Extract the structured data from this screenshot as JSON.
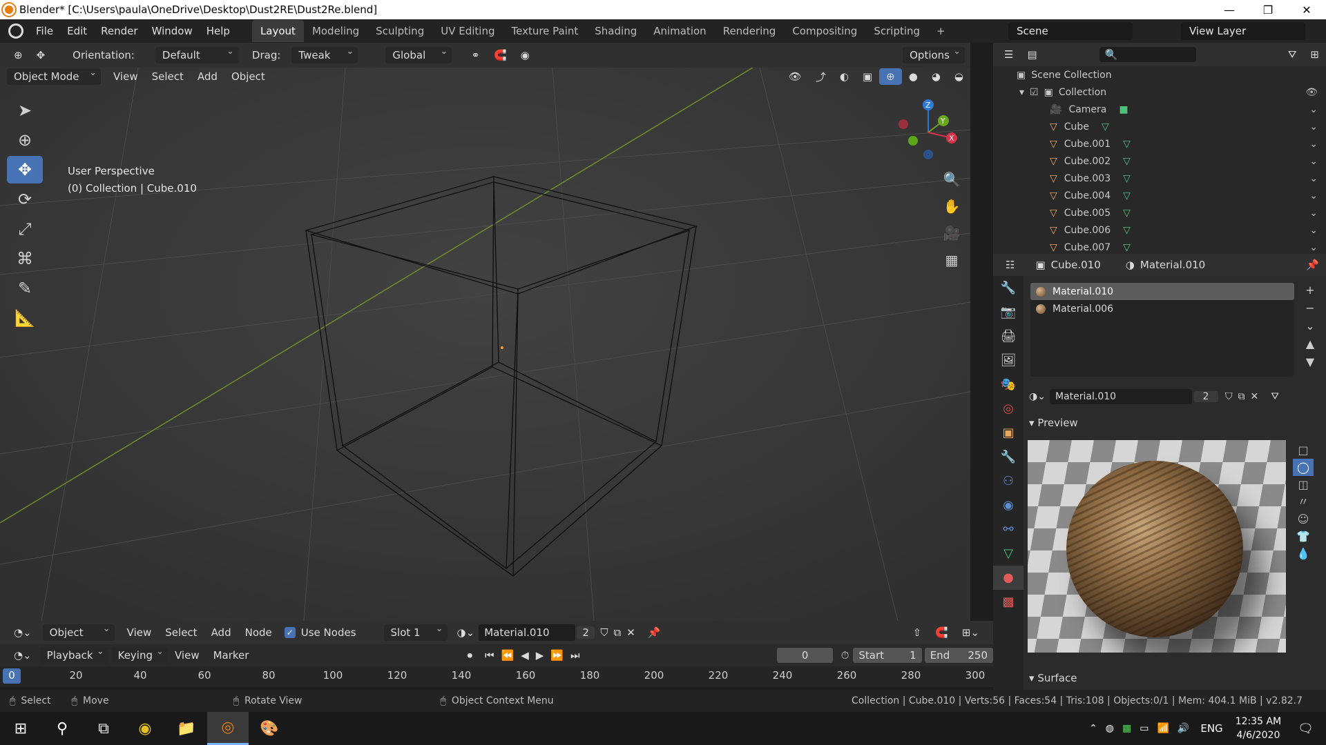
{
  "window": {
    "title": "Blender* [C:\\Users\\paula\\OneDrive\\Desktop\\Dust2RE\\Dust2Re.blend]",
    "controls": [
      "—",
      "❐",
      "✕"
    ]
  },
  "menu": [
    "File",
    "Edit",
    "Render",
    "Window",
    "Help"
  ],
  "workspaces": {
    "active": "Layout",
    "tabs": [
      "Layout",
      "Modeling",
      "Sculpting",
      "UV Editing",
      "Texture Paint",
      "Shading",
      "Animation",
      "Rendering",
      "Compositing",
      "Scripting"
    ],
    "add": "+"
  },
  "scene": {
    "label": "Scene",
    "view_layer": "View Layer"
  },
  "tool_header": {
    "orientation_label": "Orientation:",
    "orientation_value": "Default",
    "drag_label": "Drag:",
    "drag_value": "Tweak",
    "transform_orientation": "Global",
    "options": "Options"
  },
  "viewport_header": {
    "mode": "Object Mode",
    "menus": [
      "View",
      "Select",
      "Add",
      "Object"
    ]
  },
  "viewport_overlay": {
    "line1": "User Perspective",
    "line2": "(0) Collection | Cube.010"
  },
  "gizmo": {
    "x": "X",
    "y": "Y",
    "z": "Z"
  },
  "outliner": {
    "scene_collection": "Scene Collection",
    "collection": "Collection",
    "items": [
      "Camera",
      "Cube",
      "Cube.001",
      "Cube.002",
      "Cube.003",
      "Cube.004",
      "Cube.005",
      "Cube.006",
      "Cube.007"
    ]
  },
  "properties": {
    "object": "Cube.010",
    "material": "Material.010",
    "slots": [
      "Material.010",
      "Material.006"
    ],
    "material_field": "Material.010",
    "users": "2",
    "preview_label": "Preview",
    "surface_label": "Surface"
  },
  "node_header": {
    "object": "Object",
    "menus": [
      "View",
      "Select",
      "Add",
      "Node"
    ],
    "use_nodes": "Use Nodes",
    "slot": "Slot 1",
    "material": "Material.010",
    "users": "2"
  },
  "timeline": {
    "menus": [
      "Playback",
      "Keying",
      "View",
      "Marker"
    ],
    "current_frame": "0",
    "start_label": "Start",
    "start": "1",
    "end_label": "End",
    "end": "250",
    "ticks": [
      "0",
      "20",
      "40",
      "60",
      "80",
      "100",
      "120",
      "140",
      "160",
      "180",
      "200",
      "220",
      "240",
      "260",
      "280",
      "300"
    ]
  },
  "statusbar": {
    "select": "Select",
    "move": "Move",
    "rotate": "Rotate View",
    "context": "Object Context Menu",
    "stats": "Collection | Cube.010 | Verts:56 | Faces:54 | Tris:108 | Objects:0/1 | Mem: 404.1 MiB | v2.82.7"
  },
  "taskbar": {
    "lang": "ENG",
    "time": "12:35 AM",
    "date": "4/6/2020"
  },
  "colors": {
    "accent": "#4772b3",
    "active_orange": "#e87d0d",
    "mesh_green": "#4ec27a"
  }
}
